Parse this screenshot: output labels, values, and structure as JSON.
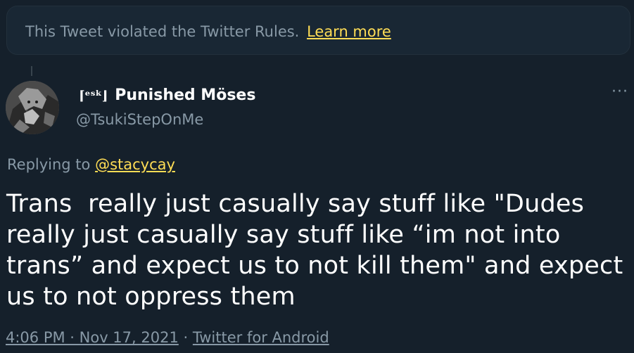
{
  "notice": {
    "text": "This Tweet violated the Twitter Rules.",
    "link": "Learn more"
  },
  "author": {
    "badge": "⌈ᵉˢᵏ⌋",
    "name": "Punished Möses",
    "handle": "@TsukiStepOnMe"
  },
  "more_label": "···",
  "reply": {
    "prefix": "Replying to",
    "handle": "@stacycay"
  },
  "tweet": {
    "text": "Trans  really just casually say stuff like \"Dudes really just casually say stuff like “im not into trans” and expect us to not kill them\" and expect us to not oppress them"
  },
  "meta": {
    "timestamp": "4:06 PM · Nov 17, 2021",
    "separator": "·",
    "source": "Twitter for Android"
  },
  "colors": {
    "background": "#15202b",
    "secondary_text": "#8899a6",
    "link": "#ffdd55"
  }
}
